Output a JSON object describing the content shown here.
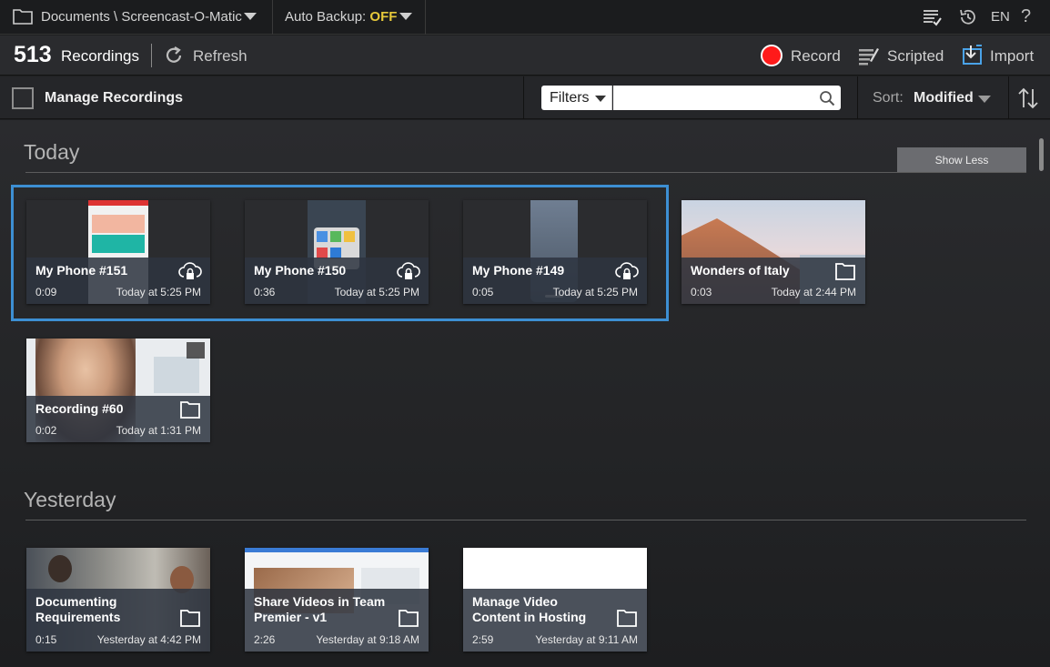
{
  "topbar": {
    "path": "Documents \\ Screencast-O-Matic",
    "backup_label": "Auto Backup:",
    "backup_state": "OFF",
    "language": "EN",
    "help": "?"
  },
  "toolbar": {
    "count": "513",
    "count_label": "Recordings",
    "refresh_label": "Refresh",
    "record_label": "Record",
    "scripted_label": "Scripted",
    "import_label": "Import"
  },
  "filterbar": {
    "manage_label": "Manage Recordings",
    "filters_label": "Filters",
    "search_value": "",
    "sort_label": "Sort:",
    "sort_value": "Modified"
  },
  "sections": {
    "today": {
      "title": "Today",
      "show_less": "Show Less",
      "items": [
        {
          "title": "My Phone #151",
          "duration": "0:09",
          "date": "Today at 5:25 PM",
          "icon": "cloud-lock-icon"
        },
        {
          "title": "My Phone #150",
          "duration": "0:36",
          "date": "Today at 5:25 PM",
          "icon": "cloud-lock-icon"
        },
        {
          "title": "My Phone #149",
          "duration": "0:05",
          "date": "Today at 5:25 PM",
          "icon": "cloud-lock-icon"
        },
        {
          "title": "Wonders of Italy",
          "duration": "0:03",
          "date": "Today at 2:44 PM",
          "icon": "folder-icon"
        },
        {
          "title": "Recording #60",
          "duration": "0:02",
          "date": "Today at 1:31 PM",
          "icon": "folder-icon"
        }
      ]
    },
    "yesterday": {
      "title": "Yesterday",
      "items": [
        {
          "title": "Documenting Requirements",
          "duration": "0:15",
          "date": "Yesterday at 4:42 PM",
          "icon": "folder-icon"
        },
        {
          "title": "Share Videos in Team Premier - v1",
          "duration": "2:26",
          "date": "Yesterday at 9:18 AM",
          "icon": "folder-icon"
        },
        {
          "title": "Manage Video Content in Hosting",
          "duration": "2:59",
          "date": "Yesterday at 9:11 AM",
          "icon": "folder-icon"
        }
      ]
    }
  },
  "colors": {
    "accent_selection": "#3d8fd3",
    "record_red": "#ff1a1a",
    "backup_off": "#e6c83a"
  }
}
